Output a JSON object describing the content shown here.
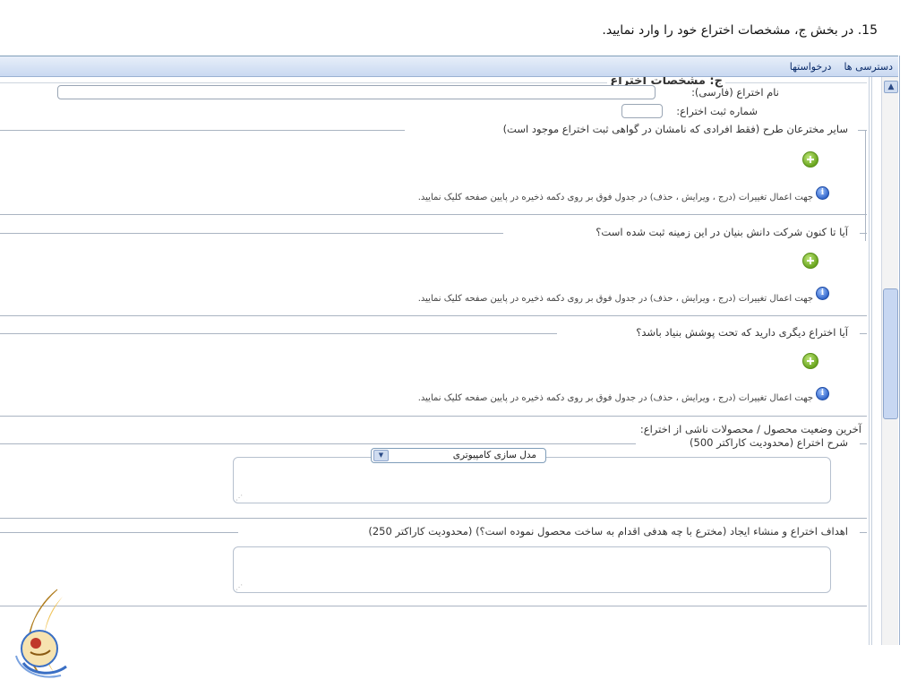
{
  "step_caption": "15.  در بخش ج، مشخصات اختراع خود را وارد نمایید.",
  "menubar": {
    "items": [
      "دسترسی ها",
      "درخواستها"
    ]
  },
  "section": {
    "title": "ج: مشخصات اختراع",
    "invention_name_label": "نام اختراع (فارسی):",
    "invention_name_value": "",
    "registration_no_label": "شماره ثبت اختراع:",
    "registration_no_value": ""
  },
  "groups": {
    "other_inventors": {
      "legend": "سایر مخترعان طرح (فقط افرادی که نامشان در گواهی ثبت اختراع موجود است)",
      "hint": "جهت اعمال تغییرات (درج ، ویرایش ، حذف) در جدول فوق بر روی دکمه ذخیره در پایین صفحه کلیک نمایید."
    },
    "knowledge_company": {
      "legend": "آیا تا کنون شرکت دانش بنیان در این زمینه ثبت شده است؟",
      "hint": "جهت اعمال تغییرات (درج ، ویرایش ، حذف) در جدول فوق بر روی دکمه ذخیره در پایین صفحه کلیک نمایید."
    },
    "other_inventions": {
      "legend": "آیا اختراع دیگری دارید که تحت پوشش بنیاد باشد؟",
      "hint": "جهت اعمال تغییرات (درج ، ویرایش ، حذف) در جدول فوق بر روی دکمه ذخیره در پایین صفحه کلیک نمایید."
    }
  },
  "product_status": {
    "label": "آخرین وضعیت محصول / محصولات ناشی از اختراع:",
    "selected": "مدل سازی کامپیوتری"
  },
  "description": {
    "legend": "شرح اختراع (محدودیت کاراکتر 500)",
    "value": ""
  },
  "goals": {
    "legend": "اهداف اختراع و منشاء ایجاد (مخترع با چه هدفی اقدام به ساخت محصول نموده است؟) (محدودیت کاراکتر 250)",
    "value": ""
  },
  "colors": {
    "menubar": "#c9d9f1",
    "add_button": "#6aa51f",
    "info_icon": "#2e62c8",
    "logo_gold": "#d9a23a",
    "logo_blue": "#3a6fc4"
  },
  "icons": {
    "add": "add-circle-icon",
    "info": "info-icon",
    "dropdown": "chevron-down-icon",
    "scroll_up": "scroll-up-arrow-icon"
  }
}
